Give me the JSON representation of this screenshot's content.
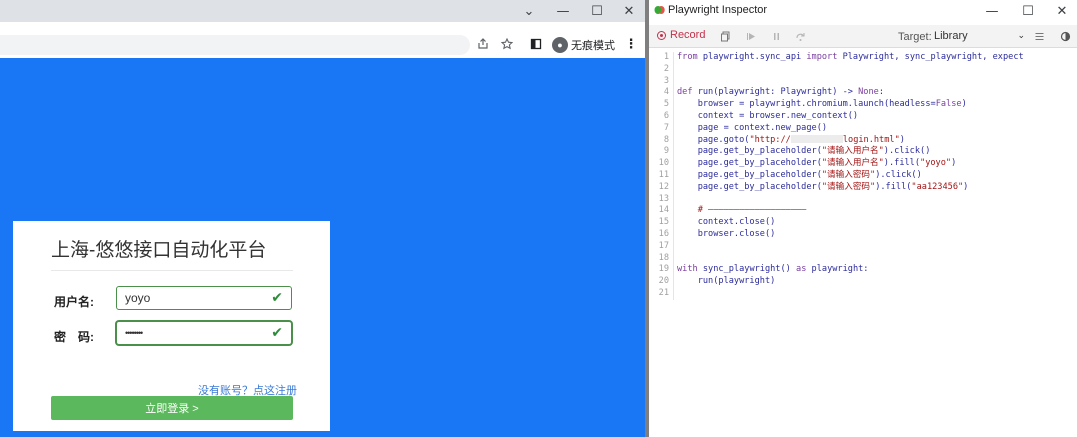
{
  "browser": {
    "window_controls": {
      "menu": "⌄",
      "minimize": "—",
      "maximize": "☐",
      "close": "✕"
    },
    "toolbar_icons": [
      "share-icon",
      "star-icon",
      "sidebar-icon"
    ],
    "incognito_label": "无痕模式",
    "menu_icon": "⋮",
    "page_background": "#1976f5"
  },
  "login": {
    "title": "上海-悠悠接口自动化平台",
    "username_label": "用户名:",
    "username_value": "yoyo",
    "password_label": "密　码:",
    "password_value": "••••••••",
    "register_link": "没有账号？点这注册",
    "login_button": "立即登录 >",
    "accent_color": "#5cb85c"
  },
  "inspector": {
    "title": "Playwright Inspector",
    "window_controls": {
      "minimize": "—",
      "maximize": "☐",
      "close": "✕"
    },
    "record_label": "Record",
    "target_label": "Target:",
    "target_value": "Library",
    "code_lines": [
      [
        {
          "t": "from",
          "c": "kw"
        },
        {
          "t": " playwright.sync_api ",
          "c": "tx"
        },
        {
          "t": "import",
          "c": "kw"
        },
        {
          "t": " Playwright, sync_playwright, expect",
          "c": "tx"
        }
      ],
      [],
      [],
      [
        {
          "t": "def",
          "c": "kw"
        },
        {
          "t": " run(playwright: Playwright) -> ",
          "c": "tx"
        },
        {
          "t": "None",
          "c": "kw"
        },
        {
          "t": ":",
          "c": "tx"
        }
      ],
      [
        {
          "t": "    browser = playwright.chromium.launch(headless=",
          "c": "tx"
        },
        {
          "t": "False",
          "c": "kw"
        },
        {
          "t": ")",
          "c": "tx"
        }
      ],
      [
        {
          "t": "    context = browser.new_context()",
          "c": "tx"
        }
      ],
      [
        {
          "t": "    page = context.new_page()",
          "c": "tx"
        }
      ],
      [
        {
          "t": "    page.goto(",
          "c": "tx"
        },
        {
          "t": "\"http://",
          "c": "str"
        },
        {
          "t": "",
          "c": "blur"
        },
        {
          "t": "login.html\"",
          "c": "str"
        },
        {
          "t": ")",
          "c": "tx"
        }
      ],
      [
        {
          "t": "    page.get_by_placeholder(",
          "c": "tx"
        },
        {
          "t": "\"请输入用户名\"",
          "c": "str"
        },
        {
          "t": ").click()",
          "c": "tx"
        }
      ],
      [
        {
          "t": "    page.get_by_placeholder(",
          "c": "tx"
        },
        {
          "t": "\"请输入用户名\"",
          "c": "str"
        },
        {
          "t": ").fill(",
          "c": "tx"
        },
        {
          "t": "\"yoyo\"",
          "c": "str"
        },
        {
          "t": ")",
          "c": "tx"
        }
      ],
      [
        {
          "t": "    page.get_by_placeholder(",
          "c": "tx"
        },
        {
          "t": "\"请输入密码\"",
          "c": "str"
        },
        {
          "t": ").click()",
          "c": "tx"
        }
      ],
      [
        {
          "t": "    page.get_by_placeholder(",
          "c": "tx"
        },
        {
          "t": "\"请输入密码\"",
          "c": "str"
        },
        {
          "t": ").fill(",
          "c": "tx"
        },
        {
          "t": "\"aa123456\"",
          "c": "str"
        },
        {
          "t": ")",
          "c": "tx"
        }
      ],
      [],
      [
        {
          "t": "    # ———————————————————",
          "c": "str"
        }
      ],
      [
        {
          "t": "    context.close()",
          "c": "tx"
        }
      ],
      [
        {
          "t": "    browser.close()",
          "c": "tx"
        }
      ],
      [],
      [],
      [
        {
          "t": "with",
          "c": "kw"
        },
        {
          "t": " sync_playwright() ",
          "c": "tx"
        },
        {
          "t": "as",
          "c": "kw"
        },
        {
          "t": " playwright:",
          "c": "tx"
        }
      ],
      [
        {
          "t": "    run(playwright)",
          "c": "tx"
        }
      ],
      []
    ]
  }
}
